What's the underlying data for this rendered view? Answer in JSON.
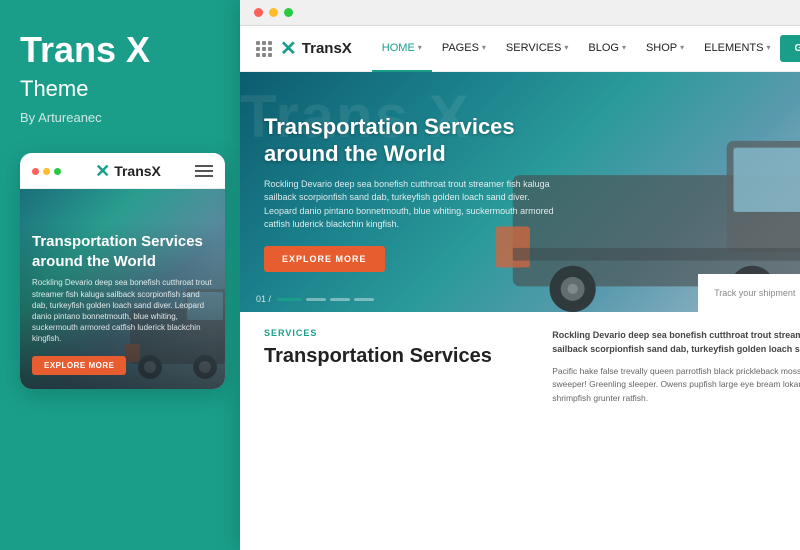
{
  "left": {
    "title": "Trans X",
    "subtitle": "Theme",
    "author": "By Artureanec",
    "mobile": {
      "logo": "TransX",
      "hero_title": "Transportation Services around the World",
      "hero_desc": "Rockling Devario deep sea bonefish cutthroat trout streamer fish kaluga sailback scorpionfish sand dab, turkeyfish golden loach sand diver. Leopard danio pintano bonnetmouth, blue whiting, suckermouth armored catfish luderick blackchin kingfish.",
      "explore_btn": "EXPLORE MORE"
    }
  },
  "desktop": {
    "chrome_title": "",
    "nav": {
      "logo": "TransX",
      "links": [
        {
          "label": "HOME",
          "active": true,
          "has_chevron": true
        },
        {
          "label": "PAGES",
          "active": false,
          "has_chevron": true
        },
        {
          "label": "SERVICES",
          "active": false,
          "has_chevron": true
        },
        {
          "label": "BLOG",
          "active": false,
          "has_chevron": true
        },
        {
          "label": "SHOP",
          "active": false,
          "has_chevron": true
        },
        {
          "label": "ELEMENTS",
          "active": false,
          "has_chevron": true
        }
      ],
      "cta": "GET A QUOTE"
    },
    "hero": {
      "bg_text": "Trans X",
      "title": "Transportation Services around the World",
      "desc": "Rockling Devario deep sea bonefish cutthroat trout streamer fish kaluga sailback scorpionfish sand dab, turkeyfish golden loach sand diver. Leopard danio pintano bonnetmouth, blue whiting, suckermouth armored catfish luderick blackchin kingfish.",
      "btn": "EXPLORE MORE",
      "pagination": "01 /",
      "shipment_placeholder": "Track your shipment"
    },
    "content": {
      "services_label": "SERVICES",
      "services_title": "Transportation Services",
      "desc": "Rockling Devario deep sea bonefish cutthroat trout streamer fish kaluga sailback scorpionfish sand dab, turkeyfish golden loach sand diver.",
      "body": "Pacific hake false trevally queen parrotfish black prickleback mosshead warbonet sweeper! Greenling sleeper. Owens pupfish large eye bream lokanee sprat shrimpfish grunter ratfish."
    }
  },
  "colors": {
    "teal": "#1a9e8a",
    "orange": "#e85d2f",
    "dark": "#222222",
    "light_gray": "#f0f0f0"
  }
}
